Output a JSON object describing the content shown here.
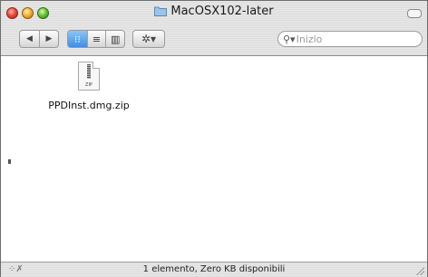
{
  "window": {
    "title": "MacOSX102-later",
    "folder_icon": "folder-icon"
  },
  "toolbar": {
    "back_icon": "◀",
    "forward_icon": "▶",
    "views": [
      {
        "name": "icon-view",
        "glyph": "⁝⁝",
        "active": true
      },
      {
        "name": "list-view",
        "glyph": "≡",
        "active": false
      },
      {
        "name": "column-view",
        "glyph": "▥",
        "active": false
      }
    ],
    "action_glyph": "✲▾",
    "search_placeholder": "Inizio"
  },
  "files": [
    {
      "name": "PPDInst.dmg.zip",
      "type_label": "ZIP",
      "icon": "zip-file-icon"
    }
  ],
  "statusbar": {
    "text": "1 elemento, Zero KB disponibili"
  },
  "colors": {
    "accent": "#3c8ee8",
    "close": "#ef4a3a",
    "minimize": "#f2b43a",
    "zoom": "#6dc43a"
  }
}
